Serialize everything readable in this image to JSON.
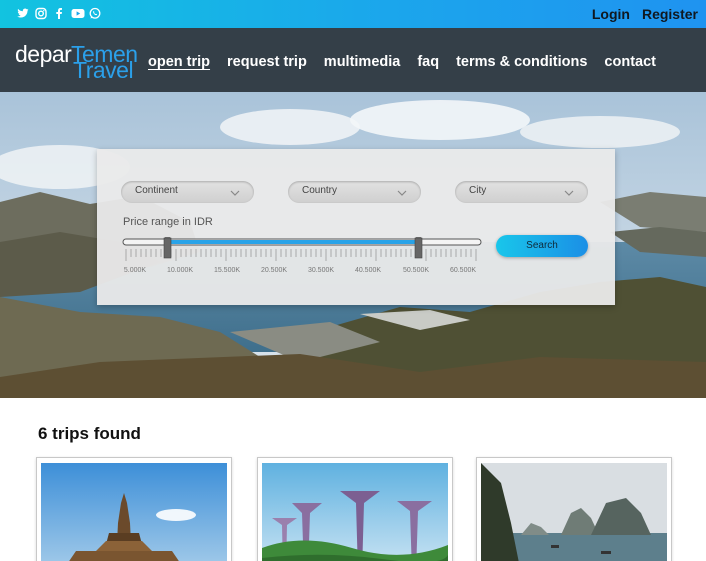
{
  "header": {
    "social_icons": [
      "twitter-icon",
      "instagram-icon",
      "facebook-icon",
      "youtube-icon",
      "whatsapp-icon"
    ],
    "login_label": "Login",
    "register_label": "Register"
  },
  "logo": {
    "part1": "depar",
    "part2": "Temen",
    "part3": "Travel"
  },
  "nav": {
    "items": [
      "open trip",
      "request trip",
      "multimedia",
      "faq",
      "terms & conditions",
      "contact"
    ],
    "active": "open trip"
  },
  "search": {
    "continent_placeholder": "Continent",
    "country_placeholder": "Country",
    "city_placeholder": "City",
    "price_label": "Price range in IDR",
    "tick_labels": [
      "5.000K",
      "10.000K",
      "15.500K",
      "20.500K",
      "30.500K",
      "40.500K",
      "50.500K",
      "60.500K"
    ],
    "range_min_value": "10.000K",
    "range_max_value": "50.500K",
    "search_label": "Search"
  },
  "results": {
    "title": "6 trips found"
  },
  "colors": {
    "accent": "#1ba6ec",
    "navbar": "#343f48",
    "slider": "#29a3e8"
  }
}
